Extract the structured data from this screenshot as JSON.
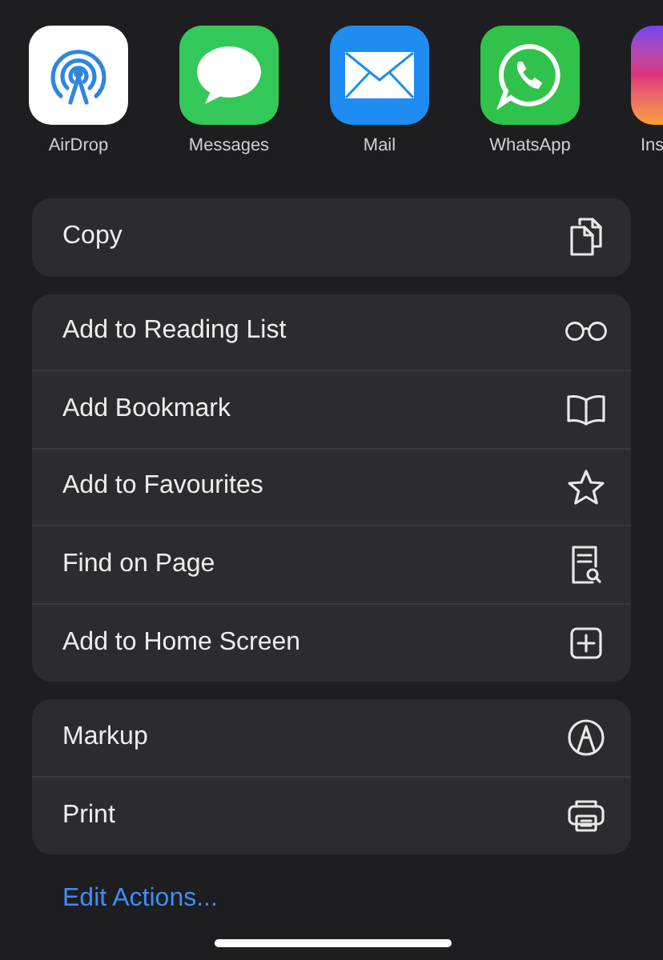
{
  "apps": [
    {
      "label": "AirDrop"
    },
    {
      "label": "Messages"
    },
    {
      "label": "Mail"
    },
    {
      "label": "WhatsApp"
    },
    {
      "label": "Ins"
    }
  ],
  "action_groups": [
    {
      "items": [
        {
          "label": "Copy"
        }
      ]
    },
    {
      "items": [
        {
          "label": "Add to Reading List"
        },
        {
          "label": "Add Bookmark"
        },
        {
          "label": "Add to Favourites"
        },
        {
          "label": "Find on Page"
        },
        {
          "label": "Add to Home Screen"
        }
      ]
    },
    {
      "items": [
        {
          "label": "Markup"
        },
        {
          "label": "Print"
        }
      ]
    }
  ],
  "edit_actions_link": "Edit Actions..."
}
